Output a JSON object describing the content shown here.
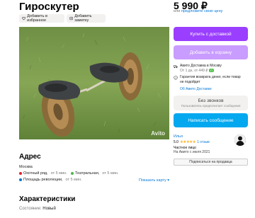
{
  "title": "Гироскутер",
  "actions": {
    "favorite": "Добавить в избранное",
    "note": "Добавить заметку"
  },
  "photo": {
    "watermark": "Avito"
  },
  "price": {
    "value": "5 990 ₽",
    "or": "или",
    "suggest": "предложите свою цену"
  },
  "buttons": {
    "buy_delivery": "Купить с доставкой",
    "add_to_cart": "Добавить в корзину",
    "no_calls": "Без звонков",
    "no_calls_sub": "Пользователь предпочитает сообщения",
    "write_message": "Написать сообщение",
    "subscribe": "Подписаться на продавца"
  },
  "delivery": {
    "line1": "Авито Доставка в Москву",
    "line2": "От 1 дн, от 449 ₽",
    "badge": "П"
  },
  "guarantee": {
    "line1": "Гарантия возврата денег, если товар",
    "line2": "не подойдет",
    "link": "Об Авито Доставке"
  },
  "seller": {
    "name": "Илья",
    "rating": "5.0",
    "stars": "★★★★★",
    "reviews": "1 отзыв",
    "type": "Частное лицо",
    "since": "На Авито с июля 2021"
  },
  "address": {
    "heading": "Адрес",
    "city": "Москва",
    "show_map": "Показать карту",
    "metro": [
      {
        "name": "Охотный ряд,",
        "dist": "от 5 мин.",
        "color": "#e4202f"
      },
      {
        "name": "Театральная,",
        "dist": "от 5 мин.",
        "color": "#4cb748"
      },
      {
        "name": "Площадь революции,",
        "dist": "от 5 мин.",
        "color": "#0078c9"
      }
    ]
  },
  "characteristics": {
    "heading": "Характеристики",
    "condition_label": "Состояние:",
    "condition_value": "Новый"
  },
  "colors": {
    "primary": "#9a3eff",
    "primary_light": "#c99cff",
    "message": "#03a8ef",
    "link": "#0a7bd8"
  }
}
